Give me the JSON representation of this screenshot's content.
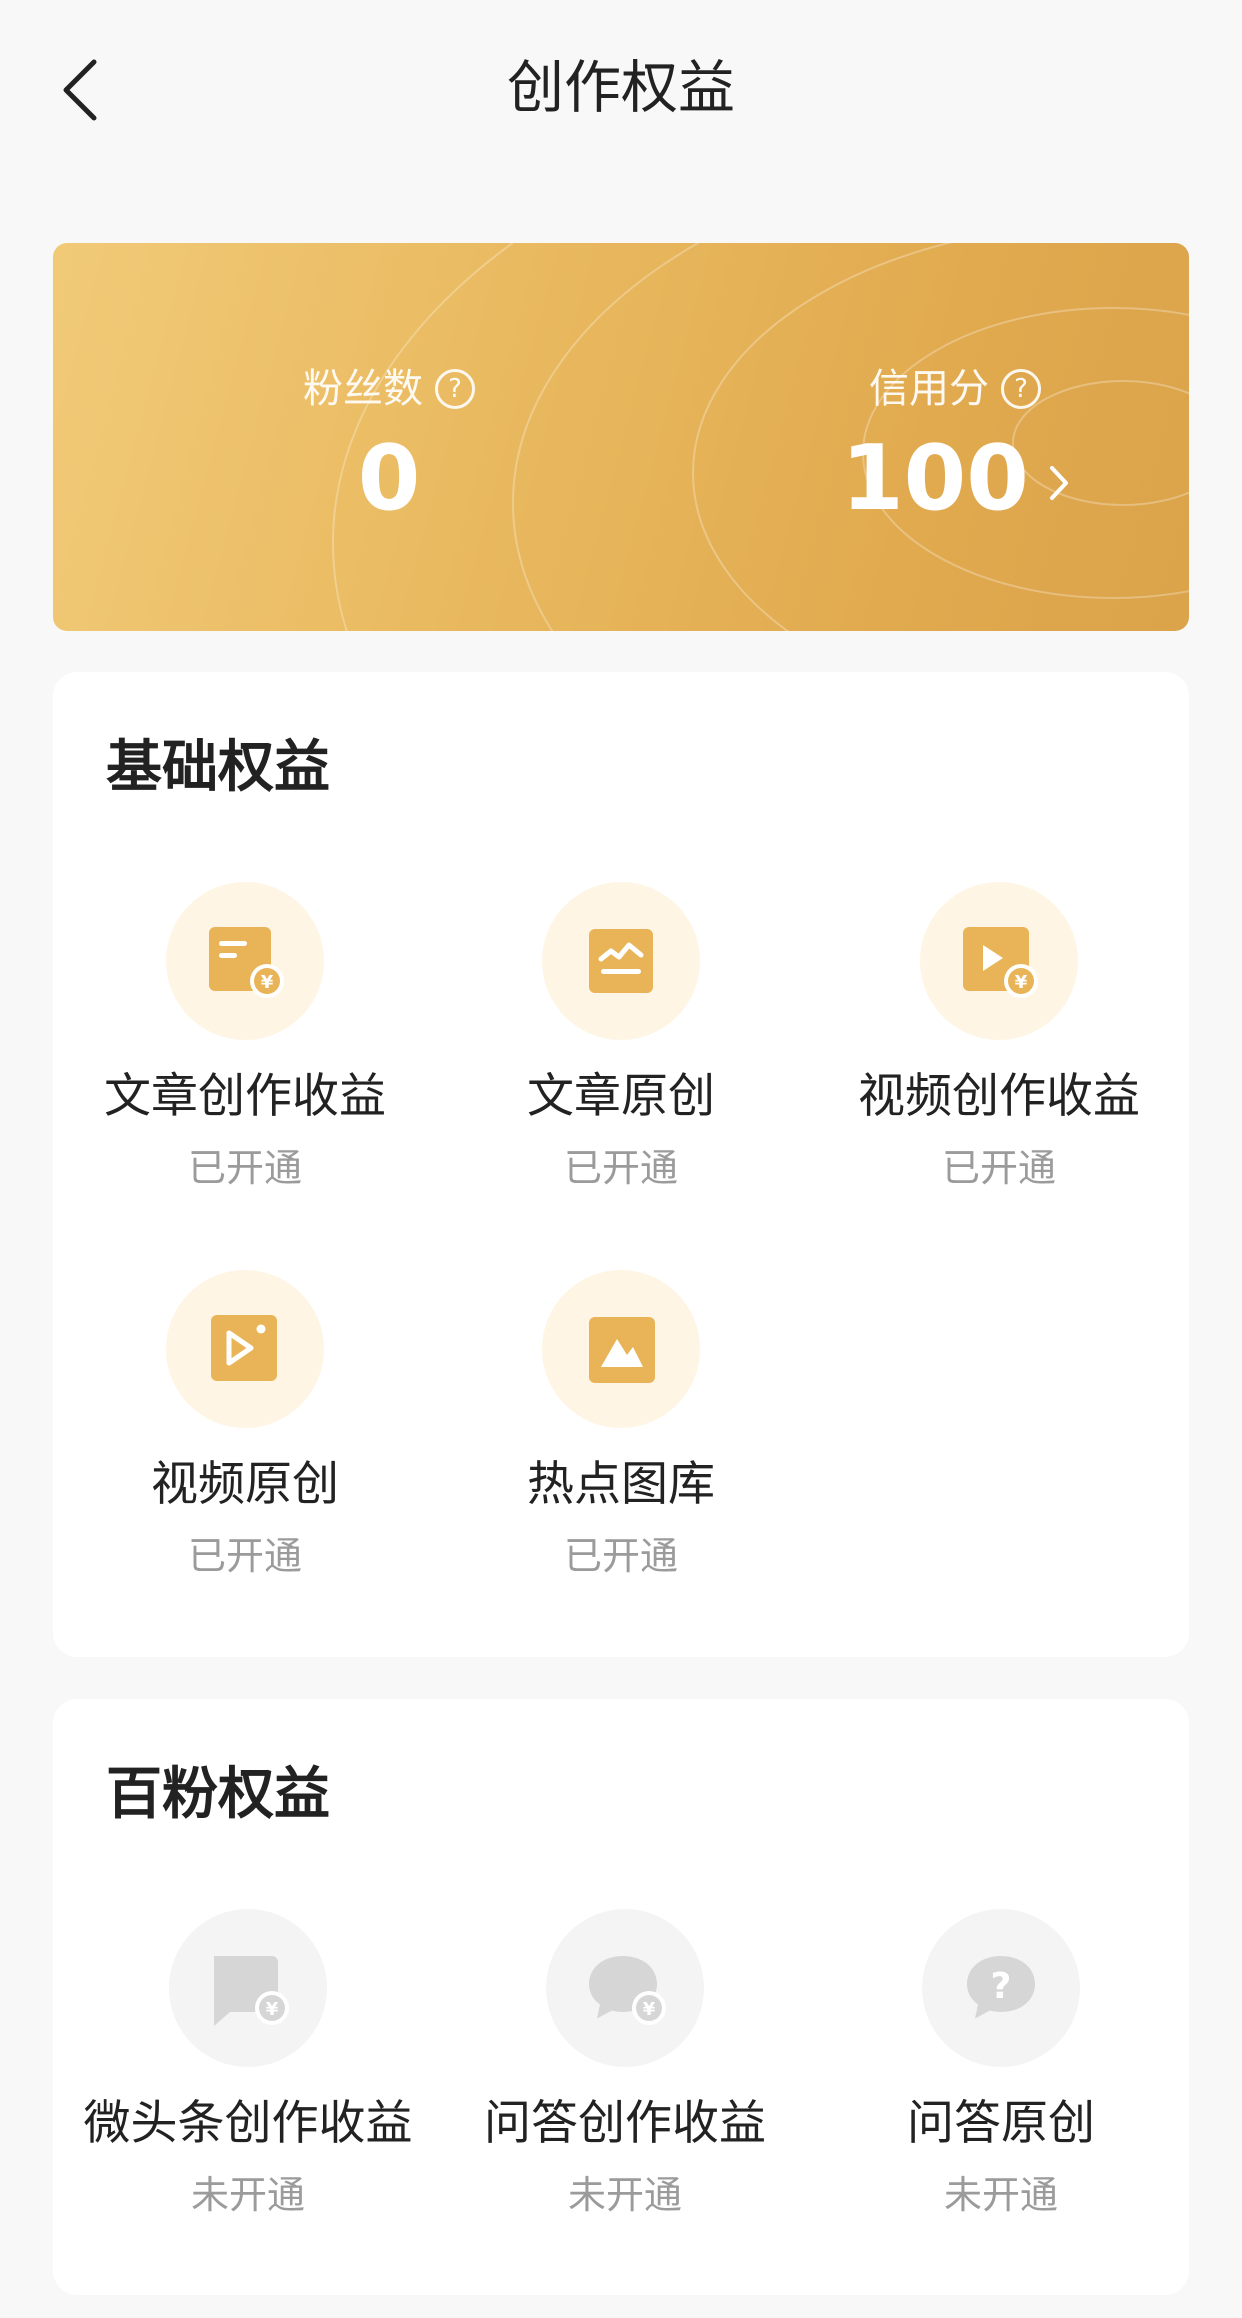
{
  "header": {
    "title": "创作权益",
    "back_icon": "chevron-left-icon"
  },
  "stats": {
    "fans": {
      "label": "粉丝数",
      "value": "0"
    },
    "credit": {
      "label": "信用分",
      "value": "100"
    },
    "help_glyph": "?"
  },
  "basic_rights": {
    "title": "基础权益",
    "items": [
      {
        "name": "文章创作收益",
        "status": "已开通",
        "icon": "article-income-icon"
      },
      {
        "name": "文章原创",
        "status": "已开通",
        "icon": "article-original-icon"
      },
      {
        "name": "视频创作收益",
        "status": "已开通",
        "icon": "video-income-icon"
      },
      {
        "name": "视频原创",
        "status": "已开通",
        "icon": "video-original-icon"
      },
      {
        "name": "热点图库",
        "status": "已开通",
        "icon": "image-library-icon"
      }
    ]
  },
  "hundred_fans_rights": {
    "title": "百粉权益",
    "items": [
      {
        "name": "微头条创作收益",
        "status": "未开通",
        "icon": "micro-post-income-icon"
      },
      {
        "name": "问答创作收益",
        "status": "未开通",
        "icon": "qa-income-icon"
      },
      {
        "name": "问答原创",
        "status": "未开通",
        "icon": "qa-original-icon"
      }
    ]
  },
  "colors": {
    "banner_start": "#f1ca78",
    "banner_end": "#dba34a",
    "icon_gold": "#e9b457",
    "icon_bg_gold": "#fef5e4",
    "icon_grey": "#d6d6d6",
    "status_text": "#9b9b9b"
  }
}
